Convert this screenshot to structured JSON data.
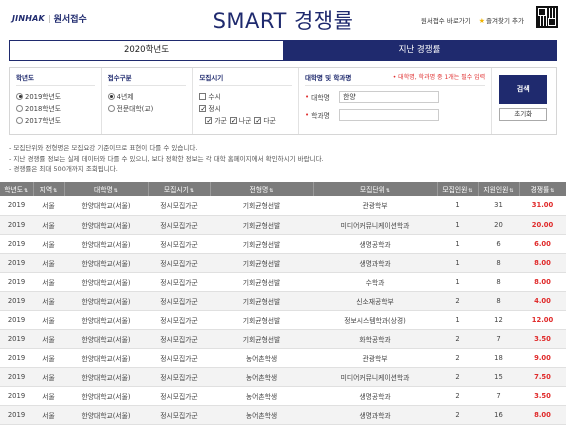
{
  "header": {
    "logo_brand": "JINHAK",
    "logo_sub": "원서접수",
    "title": "SMART 경쟁률",
    "link_apply": "원서접수 바로가기",
    "link_favorite": "즐겨찾기 추가"
  },
  "tabs": [
    {
      "label": "2020학년도",
      "active": false
    },
    {
      "label": "지난 경쟁률",
      "active": true
    }
  ],
  "filters": {
    "year": {
      "title": "학년도",
      "options": [
        {
          "label": "2019학년도",
          "checked": true
        },
        {
          "label": "2018학년도",
          "checked": false
        },
        {
          "label": "2017학년도",
          "checked": false
        }
      ]
    },
    "school_type": {
      "title": "접수구분",
      "options": [
        {
          "label": "4년제",
          "checked": true
        },
        {
          "label": "전문대학(교)",
          "checked": false
        }
      ]
    },
    "period": {
      "title": "모집시기",
      "susi": {
        "label": "수시",
        "checked": false
      },
      "jungsi": {
        "label": "정시",
        "checked": true
      },
      "groups": [
        {
          "label": "가군",
          "checked": true
        },
        {
          "label": "나군",
          "checked": true
        },
        {
          "label": "다군",
          "checked": true
        }
      ]
    },
    "univ": {
      "title": "대학명 및 학과명",
      "note": "대학명, 학과명 중 1개는 필수 입력",
      "univ_label": "대학명",
      "univ_value": "한양",
      "major_label": "학과명",
      "major_value": ""
    },
    "search_label": "검색",
    "reset_label": "초기화"
  },
  "notes": [
    "- 모집단위와 전형명은 모집요강 기준이므로 표현이 다를 수 있습니다.",
    "- 지난 경쟁률 정보는 실제 데이터와 다를 수 있으니, 보다 정확한 정보는 각 대학 홈페이지에서 확인하시기 바랍니다.",
    "- 경쟁률은 최대 500개까지 조회됩니다."
  ],
  "table": {
    "columns": [
      "학년도",
      "지역",
      "대학명",
      "모집시기",
      "전형명",
      "모집단위",
      "모집인원",
      "지원인원",
      "경쟁률"
    ],
    "sortable": [
      true,
      true,
      true,
      true,
      true,
      true,
      true,
      true,
      true
    ],
    "rows": [
      [
        "2019",
        "서울",
        "한양대학교(서울)",
        "정시모집가군",
        "기회균형선발",
        "관광학부",
        "1",
        "31",
        "31.00"
      ],
      [
        "2019",
        "서울",
        "한양대학교(서울)",
        "정시모집가군",
        "기회균형선발",
        "미디어커뮤니케이션학과",
        "1",
        "20",
        "20.00"
      ],
      [
        "2019",
        "서울",
        "한양대학교(서울)",
        "정시모집가군",
        "기회균형선발",
        "생명공학과",
        "1",
        "6",
        "6.00"
      ],
      [
        "2019",
        "서울",
        "한양대학교(서울)",
        "정시모집가군",
        "기회균형선발",
        "생명과학과",
        "1",
        "8",
        "8.00"
      ],
      [
        "2019",
        "서울",
        "한양대학교(서울)",
        "정시모집가군",
        "기회균형선발",
        "수학과",
        "1",
        "8",
        "8.00"
      ],
      [
        "2019",
        "서울",
        "한양대학교(서울)",
        "정시모집가군",
        "기회균형선발",
        "신소재공학부",
        "2",
        "8",
        "4.00"
      ],
      [
        "2019",
        "서울",
        "한양대학교(서울)",
        "정시모집가군",
        "기회균형선발",
        "정보시스템학과(상경)",
        "1",
        "12",
        "12.00"
      ],
      [
        "2019",
        "서울",
        "한양대학교(서울)",
        "정시모집가군",
        "기회균형선발",
        "화학공학과",
        "2",
        "7",
        "3.50"
      ],
      [
        "2019",
        "서울",
        "한양대학교(서울)",
        "정시모집가군",
        "농어촌학생",
        "관광학부",
        "2",
        "18",
        "9.00"
      ],
      [
        "2019",
        "서울",
        "한양대학교(서울)",
        "정시모집가군",
        "농어촌학생",
        "미디어커뮤니케이션학과",
        "2",
        "15",
        "7.50"
      ],
      [
        "2019",
        "서울",
        "한양대학교(서울)",
        "정시모집가군",
        "농어촌학생",
        "생명공학과",
        "2",
        "7",
        "3.50"
      ],
      [
        "2019",
        "서울",
        "한양대학교(서울)",
        "정시모집가군",
        "농어촌학생",
        "생명과학과",
        "2",
        "16",
        "8.00"
      ]
    ]
  },
  "colors": {
    "brand_navy": "#1f2a6e",
    "ratio_red": "#e02a2a",
    "header_gray": "#7c7c7c"
  }
}
